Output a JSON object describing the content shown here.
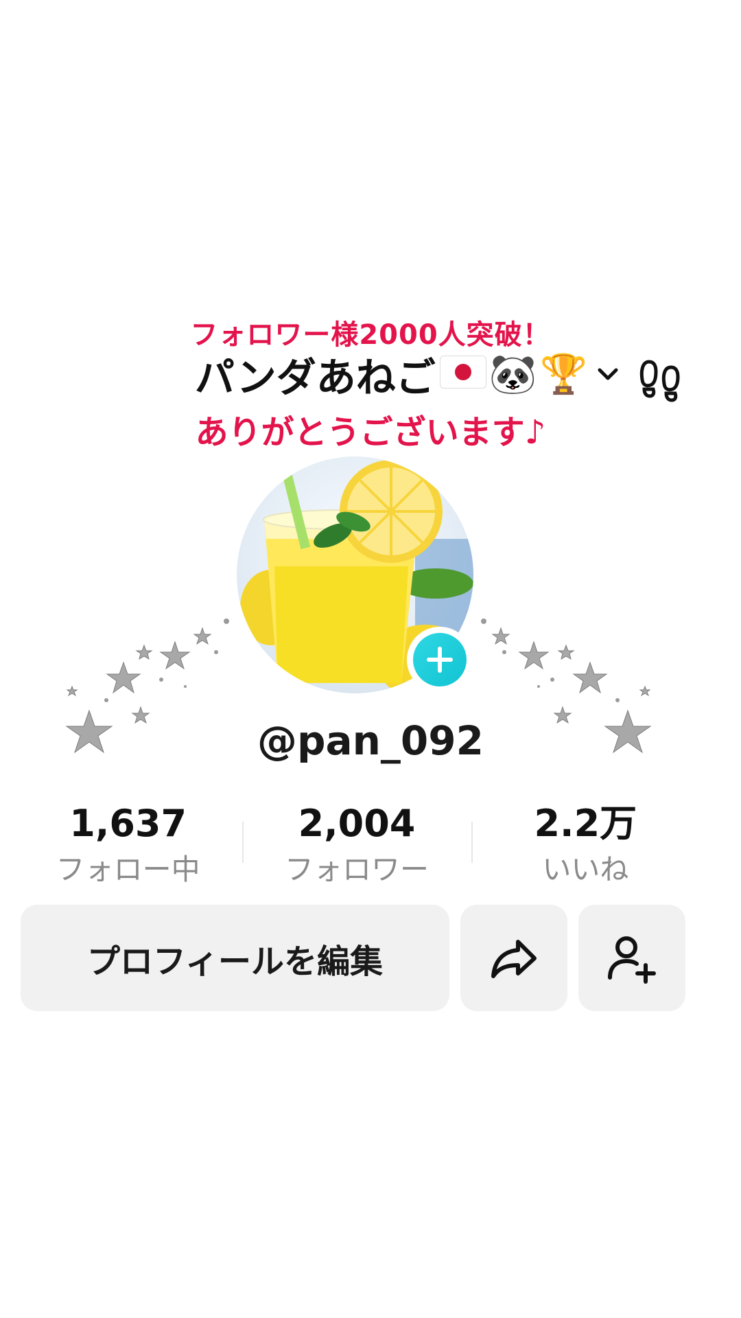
{
  "profile": {
    "banner_top": "フォロワー様2000人突破！",
    "display_name": "パンダあねご",
    "display_emojis": [
      "🐼",
      "🏆"
    ],
    "banner_bottom": "ありがとうございます♪",
    "username": "@pan_092"
  },
  "stats": [
    {
      "value": "1,637",
      "label": "フォロー中"
    },
    {
      "value": "2,004",
      "label": "フォロワー"
    },
    {
      "value": "2.2万",
      "label": "いいね"
    }
  ],
  "actions": {
    "edit_label": "プロフィールを編集",
    "share_icon": "share-arrow-icon",
    "add_friend_icon": "add-user-icon"
  },
  "icons": {
    "chevron": "chevron-down-icon",
    "footprint": "footprint-icon",
    "avatar_badge": "plus-icon"
  },
  "colors": {
    "banner": "#e3134b",
    "badge": "#1fcfdc",
    "button_bg": "#f1f1f1",
    "muted_text": "#8a8a8a"
  }
}
